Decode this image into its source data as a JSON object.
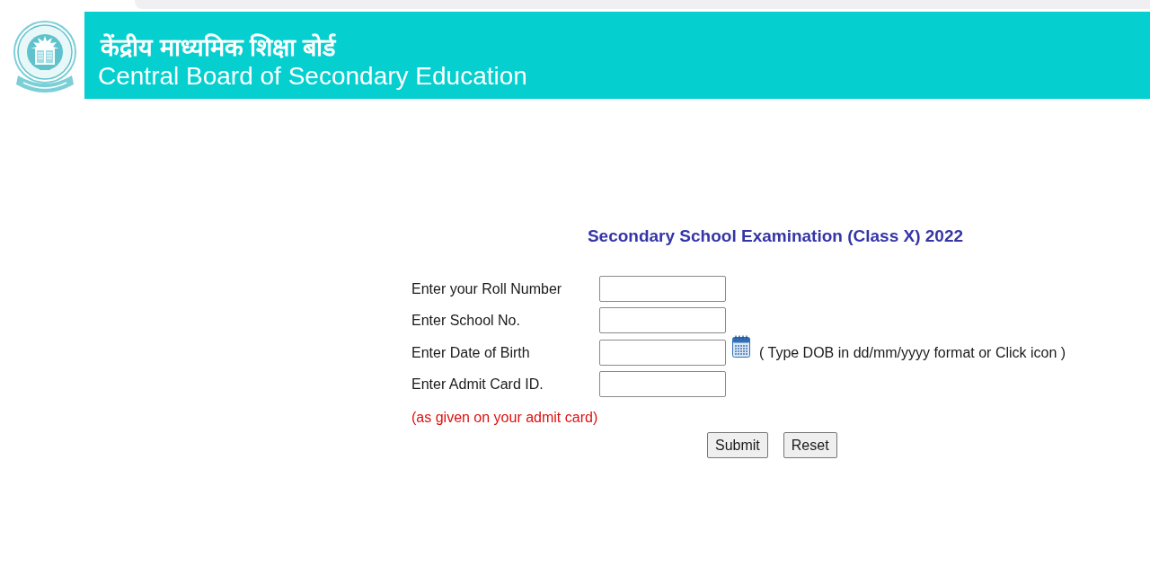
{
  "header": {
    "title_hindi": "केंद्रीय माध्यमिक शिक्षा बोर्ड",
    "title_english": "Central Board of Secondary Education"
  },
  "form": {
    "title": "Secondary School Examination (Class X) 2022",
    "fields": [
      {
        "label": "Enter your Roll Number",
        "kind": "text"
      },
      {
        "label": "Enter School No.",
        "kind": "text"
      },
      {
        "label": "Enter Date of Birth",
        "kind": "date",
        "hint": "( Type DOB in dd/mm/yyyy format or Click icon )"
      },
      {
        "label": "Enter Admit Card ID.",
        "kind": "text"
      }
    ],
    "note": "(as given on your admit card)",
    "buttons": [
      "Submit",
      "Reset"
    ]
  }
}
